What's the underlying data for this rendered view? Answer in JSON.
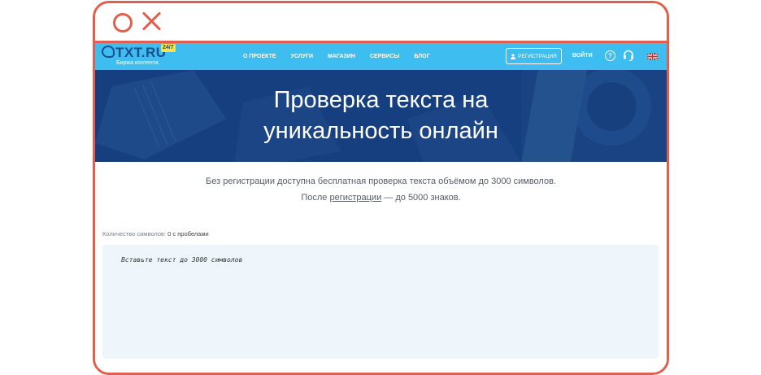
{
  "site": {
    "logo": {
      "text": "TXT.RU",
      "badge": "24/7",
      "subtitle": "Биржа контента"
    },
    "nav": {
      "items": [
        {
          "label": "О ПРОЕКТЕ"
        },
        {
          "label": "УСЛУГИ"
        },
        {
          "label": "МАГАЗИН"
        },
        {
          "label": "СЕРВИСЫ"
        },
        {
          "label": "БЛОГ"
        }
      ],
      "register_label": "РЕГИСТРАЦИЯ",
      "login_label": "ВОЙТИ",
      "help_glyph": "?",
      "icons": [
        "help-icon",
        "support-headset-icon",
        "uk-flag-icon"
      ]
    },
    "hero": {
      "title_line1": "Проверка текста на",
      "title_line2": "уникальность онлайн"
    },
    "info": {
      "line1": "Без регистрации доступна бесплатная проверка текста объёмом до 3000 символов.",
      "line2_before": "После ",
      "line2_link": "регистрации",
      "line2_after": " — до 5000 знаков."
    },
    "counter": {
      "label": "Количество символов:",
      "value": "0 с пробелами"
    },
    "editor": {
      "placeholder": "Вставьте текст до 3000 символов"
    }
  },
  "colors": {
    "frame": "#e0604e",
    "nav_bg": "#3dbdf0",
    "hero_bg": "#153f7e",
    "editor_bg": "#eef6fb",
    "logo_dark": "#1a4f8c",
    "badge": "#f6e44a"
  }
}
